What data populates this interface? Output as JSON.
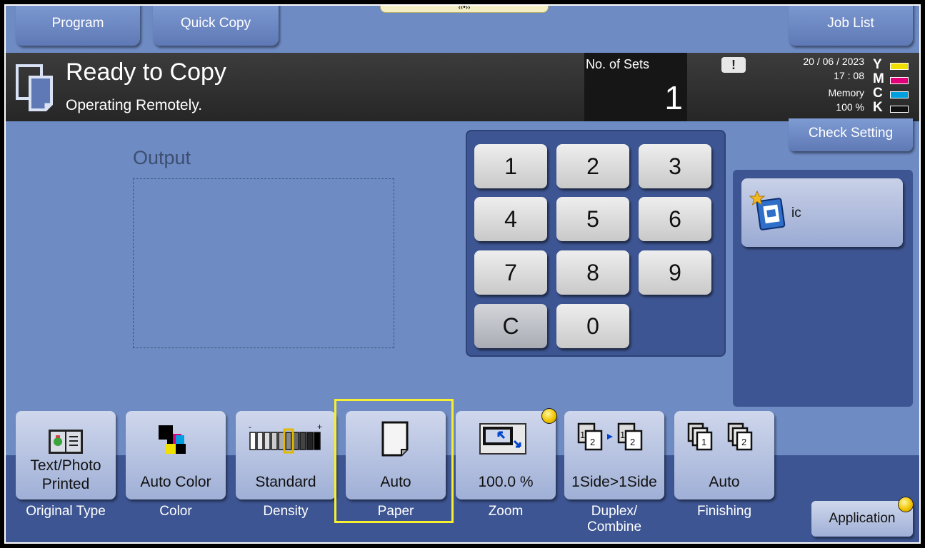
{
  "tabs": {
    "program": "Program",
    "quick_copy": "Quick Copy",
    "job_list": "Job List",
    "handle": "‹‹•››"
  },
  "status": {
    "title": "Ready to Copy",
    "subtitle": "Operating Remotely.",
    "sets_label": "No. of Sets",
    "sets_value": "1",
    "alert_glyph": "!",
    "date": "20 / 06 / 2023",
    "time": "17 : 08",
    "memory_label": "Memory",
    "memory_value": "100 %",
    "toners": [
      {
        "letter": "Y",
        "color": "#f0e000"
      },
      {
        "letter": "M",
        "color": "#e0007a"
      },
      {
        "letter": "C",
        "color": "#00a0e0"
      },
      {
        "letter": "K",
        "color": "#111111"
      }
    ]
  },
  "output": {
    "label": "Output"
  },
  "keypad": {
    "keys": [
      "1",
      "2",
      "3",
      "4",
      "5",
      "6",
      "7",
      "8",
      "9",
      "C",
      "0"
    ]
  },
  "check_setting": "Check Setting",
  "shortcut": {
    "label": "ic",
    "icon": "copy-program-icon"
  },
  "functions": [
    {
      "id": "original-type",
      "value": "Text/Photo\nPrinted",
      "label": "Original Type",
      "icon": "original-type-icon"
    },
    {
      "id": "color",
      "value": "Auto Color",
      "label": "Color",
      "icon": "color-icon"
    },
    {
      "id": "density",
      "value": "Standard",
      "label": "Density",
      "icon": "density-icon"
    },
    {
      "id": "paper",
      "value": "Auto",
      "label": "Paper",
      "icon": "paper-icon"
    },
    {
      "id": "zoom",
      "value": "100.0 %",
      "label": "Zoom",
      "icon": "zoom-icon"
    },
    {
      "id": "duplex",
      "value": "1Side>1Side",
      "label": "Duplex/\nCombine",
      "icon": "duplex-icon"
    },
    {
      "id": "finishing",
      "value": "Auto",
      "label": "Finishing",
      "icon": "finishing-icon"
    }
  ],
  "application": "Application",
  "colors": {
    "background": "#6e8bc4",
    "panel": "#3d5592",
    "highlight": "#f7ef2f"
  }
}
